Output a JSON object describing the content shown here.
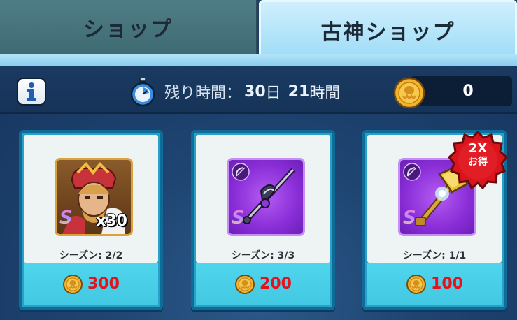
{
  "tabs": [
    {
      "label": "ショップ",
      "active": false
    },
    {
      "label": "古神ショップ",
      "active": true
    }
  ],
  "timer": {
    "label": "残り時間：",
    "days": "30",
    "day_unit": "日",
    "hours": "21",
    "hour_unit": "時間"
  },
  "currency": {
    "amount": "0"
  },
  "cards": [
    {
      "season": "シーズン: 2/2",
      "price": "300",
      "rank": "S",
      "quantity": "x30",
      "item": "hero-fragment"
    },
    {
      "season": "シーズン: 3/3",
      "price": "200",
      "rank": "S",
      "item": "bow-weapon"
    },
    {
      "season": "シーズン: 1/1",
      "price": "100",
      "rank": "S",
      "item": "hammer-weapon"
    }
  ],
  "badge": {
    "line1": "2X",
    "line2": "お得"
  },
  "colors": {
    "price": "#e4121c",
    "coin": "#f2b52c",
    "tab_active": "#b8e6fa"
  }
}
